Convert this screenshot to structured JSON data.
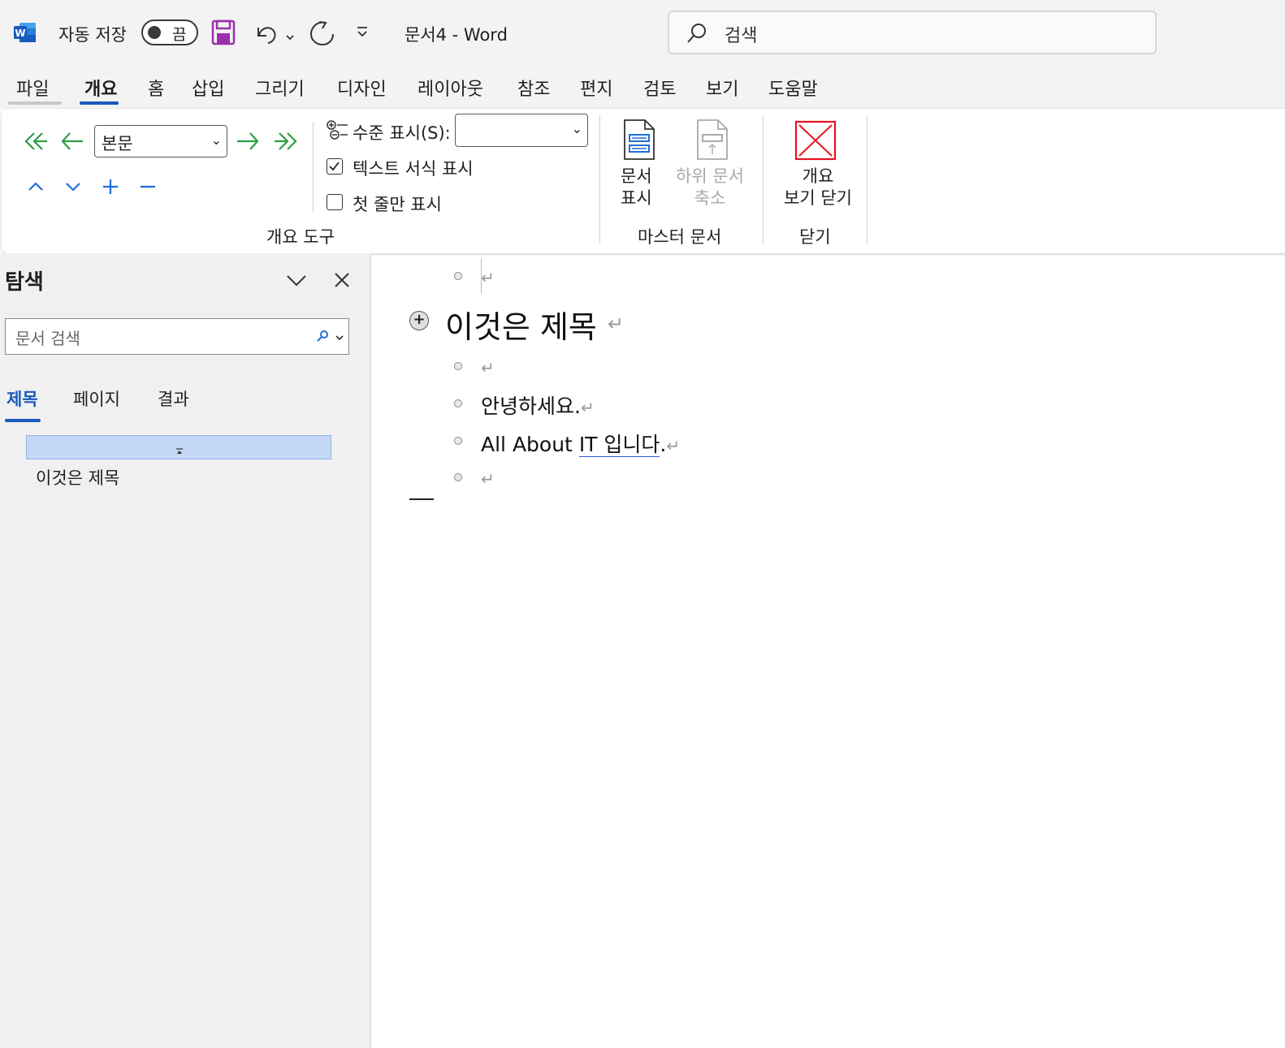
{
  "titlebar": {
    "autosave_label": "자동 저장",
    "autosave_state": "끔",
    "doc_title": "문서4  -  Word",
    "search_placeholder": "검색"
  },
  "tabs": [
    {
      "label": "파일"
    },
    {
      "label": "개요",
      "active": true
    },
    {
      "label": "홈"
    },
    {
      "label": "삽입"
    },
    {
      "label": "그리기"
    },
    {
      "label": "디자인"
    },
    {
      "label": "레이아웃"
    },
    {
      "label": "참조"
    },
    {
      "label": "편지"
    },
    {
      "label": "검토"
    },
    {
      "label": "보기"
    },
    {
      "label": "도움말"
    }
  ],
  "ribbon": {
    "level_value": "본문",
    "show_level_label": "수준 표시(S):",
    "show_level_value": "",
    "show_text_formatting": {
      "label": "텍스트 서식 표시",
      "checked": true
    },
    "show_first_line_only": {
      "label": "첫 줄만 표시",
      "checked": false
    },
    "group_outline_tools": "개요 도구",
    "show_document": "문서\n표시",
    "collapse_subdocuments": "하위 문서\n축소",
    "group_master_document": "마스터 문서",
    "close_outline_view": "개요\n보기 닫기",
    "group_close": "닫기"
  },
  "nav": {
    "title": "탐색",
    "search_placeholder": "문서 검색",
    "tabs": [
      {
        "label": "제목",
        "active": true
      },
      {
        "label": "페이지"
      },
      {
        "label": "결과"
      }
    ],
    "heading_item": "이것은 제목"
  },
  "document": {
    "heading": "이것은 제목",
    "line1": "안녕하세요.",
    "line2_prefix": "All About ",
    "line2_underlined": "IT 입니다",
    "line2_suffix": ".",
    "para_mark": "↵"
  },
  "colors": {
    "accent": "#185abd",
    "green_arrows": "#2e9e47",
    "blue_arrows": "#1e6fd9",
    "close_red": "#e81123",
    "save_purple": "#9b2fae"
  }
}
